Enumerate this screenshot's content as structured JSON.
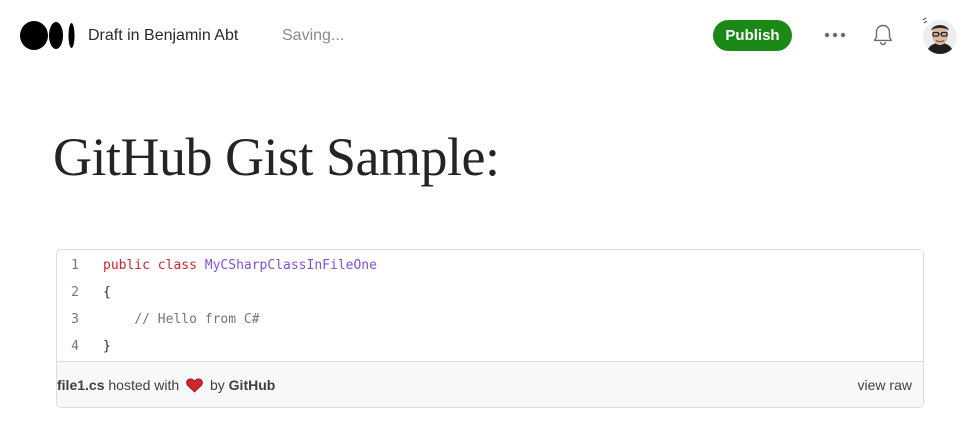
{
  "header": {
    "draft_label": "Draft in Benjamin Abt",
    "saving_label": "Saving...",
    "publish_label": "Publish",
    "logo_icon": "medium-logo-icon",
    "more_icon": "more-horizontal-icon",
    "bell_icon": "bell-icon",
    "avatar_icon": "user-avatar",
    "colors": {
      "publish_bg": "#1a8917",
      "text": "#292929",
      "muted": "#8a8a8a"
    }
  },
  "article": {
    "title": "GitHub Gist Sample:"
  },
  "gist": {
    "lines": [
      {
        "num": "1",
        "parts": [
          {
            "t": "public",
            "c": "kw"
          },
          {
            "t": " ",
            "c": ""
          },
          {
            "t": "class",
            "c": "kw"
          },
          {
            "t": " ",
            "c": ""
          },
          {
            "t": "MyCSharpClassInFileOne",
            "c": "cls"
          }
        ]
      },
      {
        "num": "2",
        "parts": [
          {
            "t": "{",
            "c": ""
          }
        ]
      },
      {
        "num": "3",
        "parts": [
          {
            "t": "    ",
            "c": ""
          },
          {
            "t": "// Hello from C#",
            "c": "com"
          }
        ]
      },
      {
        "num": "4",
        "parts": [
          {
            "t": "}",
            "c": ""
          }
        ]
      }
    ],
    "footer": {
      "filename": "file1.cs",
      "hosted_with": "hosted with",
      "heart_icon": "heart-icon",
      "by": "by",
      "github": "GitHub",
      "view_raw": "view raw"
    },
    "colors": {
      "keyword": "#cf222e",
      "class_name": "#8250df",
      "comment": "#6e7781",
      "heart": "#d1242f"
    }
  }
}
